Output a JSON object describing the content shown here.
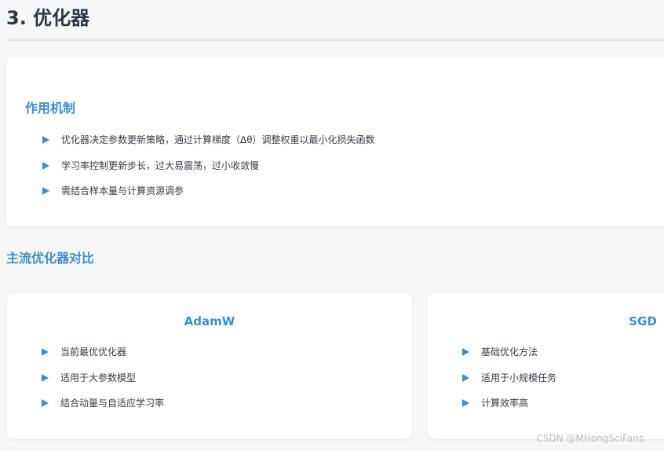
{
  "page": {
    "title": "3. 优化器"
  },
  "mechanism": {
    "heading": "作用机制",
    "items": [
      "优化器决定参数更新策略，通过计算梯度（Δθ）调整权重以最小化损失函数",
      "学习率控制更新步长，过大易震荡，过小收敛慢",
      "需结合样本量与计算资源调参"
    ]
  },
  "comparison": {
    "heading": "主流优化器对比",
    "cards": [
      {
        "title": "AdamW",
        "items": [
          "当前最优优化器",
          "适用于大参数模型",
          "结合动量与自适应学习率"
        ]
      },
      {
        "title": "SGD",
        "items": [
          "基础优化方法",
          "适用于小规模任务",
          "计算效率高"
        ]
      }
    ]
  },
  "watermark": "CSDN @MHongSciFans",
  "colors": {
    "accent": "#3a8fd0",
    "title": "#2c3645",
    "text": "#333c48",
    "background": "#f6f7f9"
  }
}
